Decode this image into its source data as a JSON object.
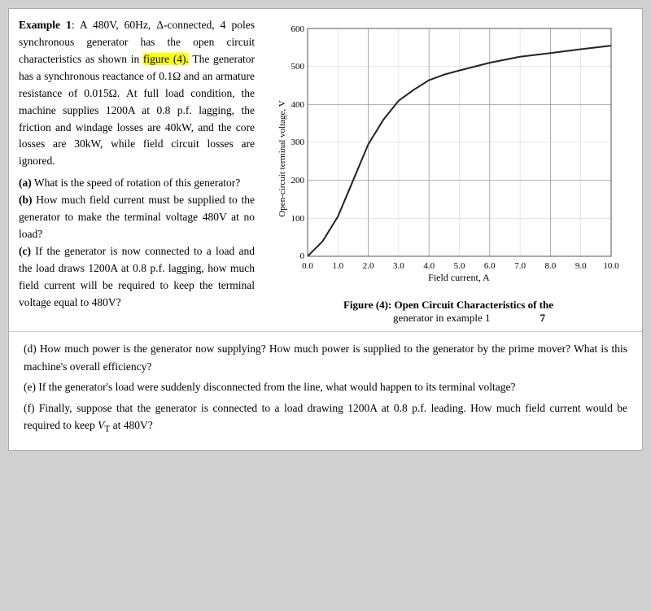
{
  "example": {
    "title": "Example 1",
    "colon": ":",
    "description_1": " A 480V, 60Hz, Δ-connected, 4 poles synchronous generator has the open circuit characteristics as shown in ",
    "figure_ref": "figure (4).",
    "description_2": " The generator has a synchronous reactance of 0.1Ω and an armature resistance of 0.015Ω. At full load condition, the machine supplies 1200A at 0.8 p.f. lagging, the friction and windage losses are 40kW, and the core losses are 30kW, while field circuit losses are ignored.",
    "q_a_label": "(a)",
    "q_a_text": " What is the speed of rotation of this generator?",
    "q_b_label": "(b)",
    "q_b_text": " How much field current must be supplied to the generator to make the terminal voltage 480V at no load?",
    "q_c_label": "(c)",
    "q_c_text": " If the generator is now connected to a load and the load draws 1200A at 0.8 p.f. lagging, how much field current will be required to keep the terminal voltage equal to 480V?"
  },
  "figure": {
    "caption_bold": "Figure (4): Open Circuit Characteristics of the",
    "caption_normal": "generator in example 1",
    "number": "7"
  },
  "chart": {
    "y_label": "Open-circuit terminal voltage, V",
    "x_label": "Field current, A",
    "y_max": 600,
    "y_ticks": [
      0,
      100,
      200,
      300,
      400,
      500,
      600
    ],
    "x_ticks": [
      0.0,
      1.0,
      2.0,
      3.0,
      4.0,
      5.0,
      6.0,
      7.0,
      8.0,
      9.0,
      10.0
    ]
  },
  "bottom": {
    "d_label": "(d)",
    "d_text": " How much power is the generator now supplying? How much power is supplied to the generator by the prime mover? What is this machine's overall efficiency?",
    "e_label": "(e)",
    "e_text": " If the generator's load were suddenly disconnected from the line, what would happen to its terminal voltage?",
    "f_label": "(f)",
    "f_text_1": " Finally, suppose that the generator is connected to a load drawing 1200A at 0.8 p.f. leading. How much field current would be required to keep ",
    "f_vt": "V",
    "f_vt_sub": "T",
    "f_text_2": " at 480V?"
  }
}
